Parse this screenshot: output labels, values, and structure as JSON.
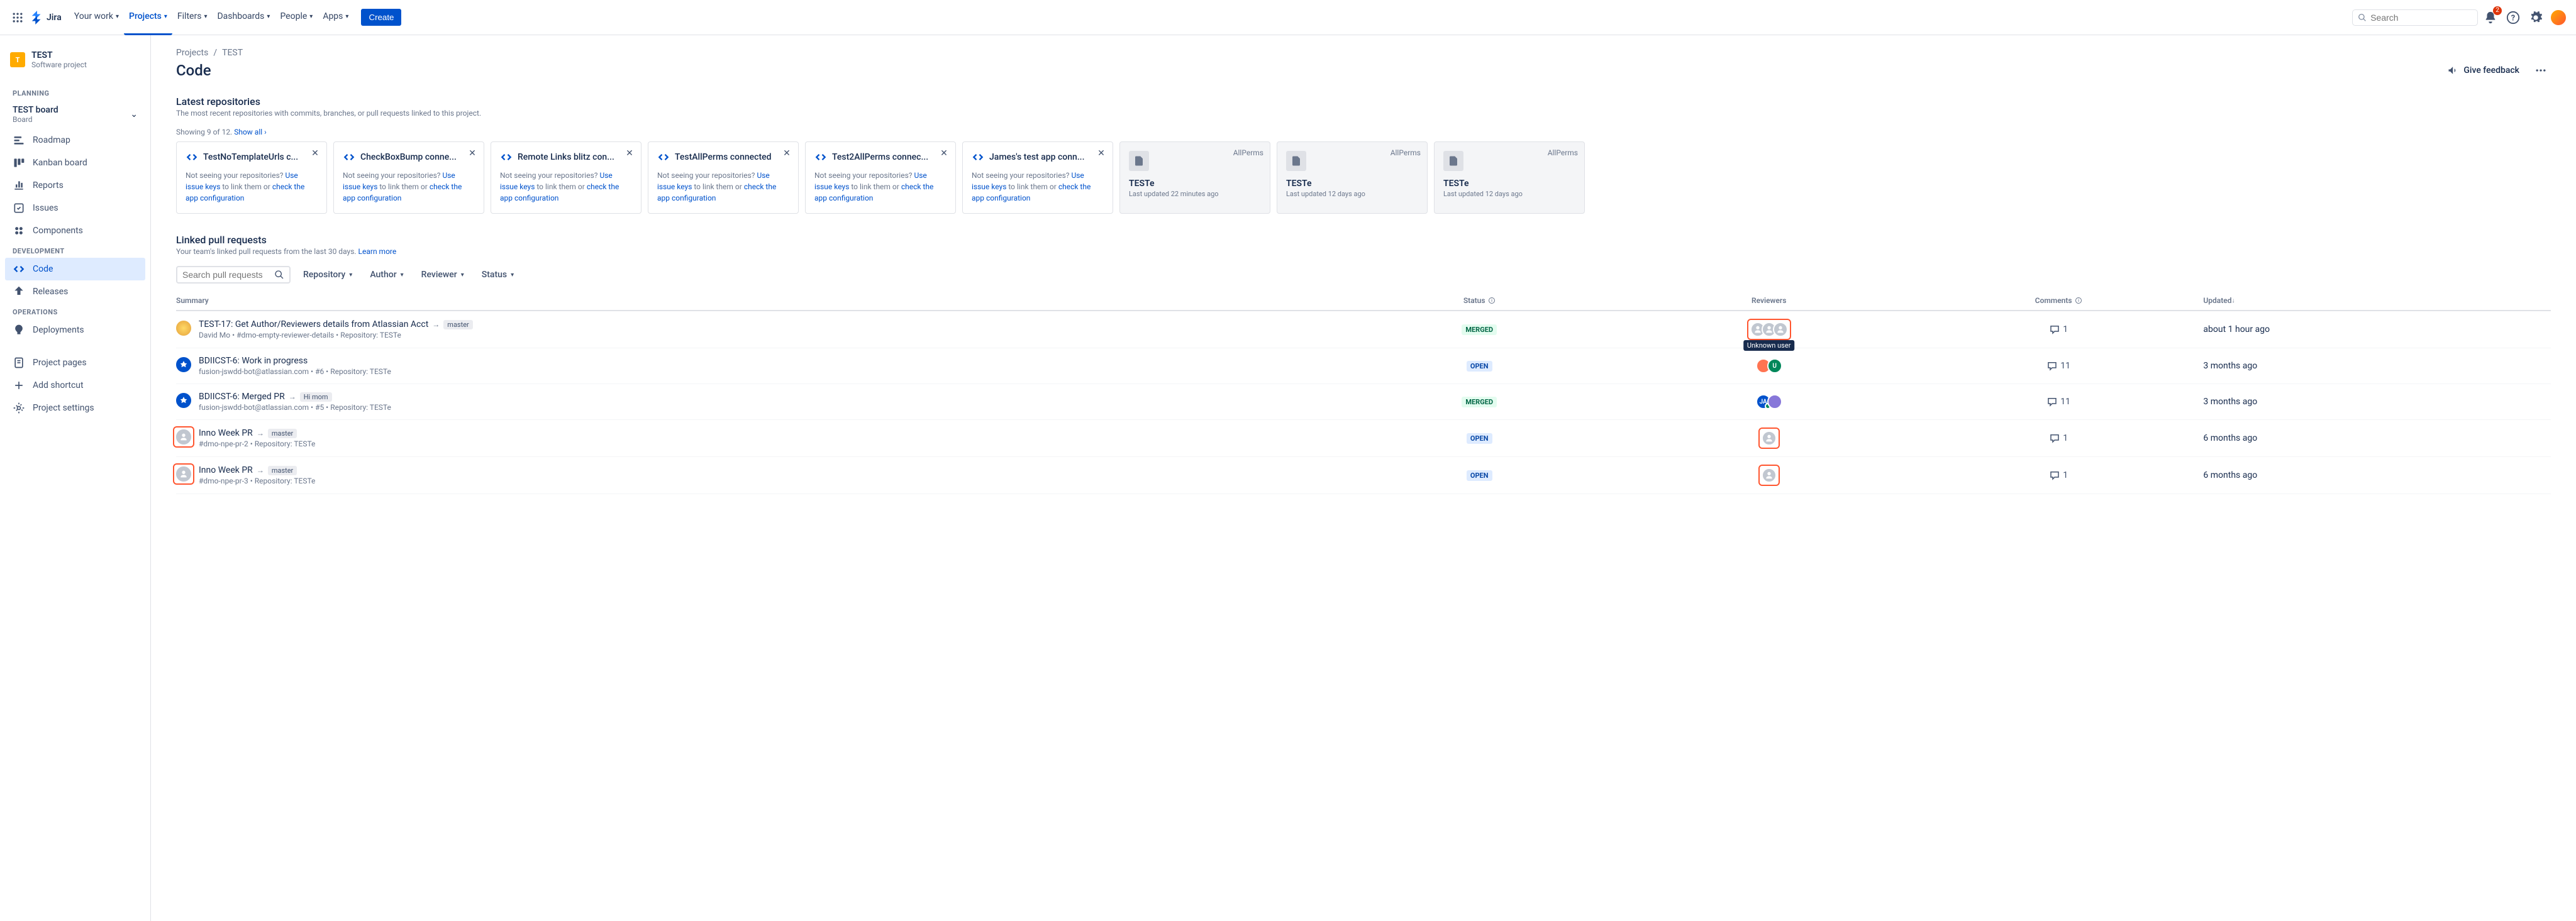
{
  "topnav": {
    "logo": "Jira",
    "items": [
      "Your work",
      "Projects",
      "Filters",
      "Dashboards",
      "People",
      "Apps"
    ],
    "active_index": 1,
    "create": "Create",
    "search_placeholder": "Search",
    "notif_count": "2"
  },
  "sidebar": {
    "project": {
      "name": "TEST",
      "type": "Software project",
      "initials": "T"
    },
    "board": {
      "name": "TEST board",
      "sub": "Board"
    },
    "sections": [
      {
        "title": "PLANNING",
        "has_board": true,
        "items": [
          {
            "label": "Roadmap",
            "icon": "roadmap"
          },
          {
            "label": "Kanban board",
            "icon": "board"
          },
          {
            "label": "Reports",
            "icon": "reports"
          },
          {
            "label": "Issues",
            "icon": "issues"
          },
          {
            "label": "Components",
            "icon": "components"
          }
        ]
      },
      {
        "title": "DEVELOPMENT",
        "items": [
          {
            "label": "Code",
            "icon": "code",
            "selected": true
          },
          {
            "label": "Releases",
            "icon": "releases"
          }
        ]
      },
      {
        "title": "OPERATIONS",
        "items": [
          {
            "label": "Deployments",
            "icon": "deployments"
          }
        ]
      }
    ],
    "footer_items": [
      {
        "label": "Project pages",
        "icon": "pages"
      },
      {
        "label": "Add shortcut",
        "icon": "add"
      },
      {
        "label": "Project settings",
        "icon": "settings"
      }
    ]
  },
  "breadcrumb": {
    "a": "Projects",
    "b": "TEST"
  },
  "page": {
    "title": "Code",
    "feedback": "Give feedback"
  },
  "latest_repos": {
    "title": "Latest repositories",
    "sub": "The most recent repositories with commits, branches, or pull requests linked to this project.",
    "showing": "Showing 9 of 12.",
    "show_all": "Show all",
    "help_prefix": "Not seeing your repositories? ",
    "help_link1": "Use issue keys",
    "help_mid": " to link them or ",
    "help_link2": "check the app configuration",
    "cards": [
      {
        "name": "TestNoTemplateUrls c...",
        "type": "link"
      },
      {
        "name": "CheckBoxBump conne...",
        "type": "link"
      },
      {
        "name": "Remote Links blitz con...",
        "type": "link"
      },
      {
        "name": "TestAllPerms connected",
        "type": "link"
      },
      {
        "name": "Test2AllPerms connec...",
        "type": "link"
      },
      {
        "name": "James's test app conn...",
        "type": "link"
      },
      {
        "name": "TESTe",
        "perm": "AllPerms",
        "updated": "Last updated 22 minutes ago",
        "type": "gray"
      },
      {
        "name": "TESTe",
        "perm": "AllPerms",
        "updated": "Last updated 12 days ago",
        "type": "gray"
      },
      {
        "name": "TESTe",
        "perm": "AllPerms",
        "updated": "Last updated 12 days ago",
        "type": "gray"
      }
    ]
  },
  "linked_prs": {
    "title": "Linked pull requests",
    "sub_pre": "Your team's linked pull requests from the last 30 days. ",
    "learn_more": "Learn more",
    "search_placeholder": "Search pull requests",
    "filters": [
      "Repository",
      "Author",
      "Reviewer",
      "Status"
    ],
    "columns": {
      "summary": "Summary",
      "status": "Status",
      "reviewers": "Reviewers",
      "comments": "Comments",
      "updated": "Updated"
    },
    "tooltip": "Unknown user",
    "rows": [
      {
        "avatar": "doge",
        "title": "TEST-17: Get Author/Reviewers details from Atlassian Acct",
        "branch": "master",
        "meta": "David Mo • #dmo-empty-reviewer-details • Repository: TESTe",
        "status": "MERGED",
        "reviewers": [
          {
            "c": "#C1C7D0",
            "t": "?"
          },
          {
            "c": "#C1C7D0",
            "t": "?"
          },
          {
            "c": "#C1C7D0",
            "t": "?"
          }
        ],
        "rev_highlight": true,
        "avatar_highlight": false,
        "tooltip": true,
        "comments": "1",
        "updated": "about 1 hour ago"
      },
      {
        "avatar": "bot",
        "title": "BDIICST-6: Work in progress",
        "branch": "",
        "meta": "fusion-jswdd-bot@atlassian.com • #6 • Repository: TESTe",
        "status": "OPEN",
        "reviewers": [
          {
            "c": "#FF7452",
            "t": ""
          },
          {
            "c": "#00875A",
            "t": "U"
          }
        ],
        "rev_highlight": false,
        "avatar_highlight": false,
        "comments": "11",
        "updated": "3 months ago"
      },
      {
        "avatar": "bot",
        "title": "BDIICST-6: Merged PR",
        "branch": "Hi mom",
        "meta": "fusion-jswdd-bot@atlassian.com • #5 • Repository: TESTe",
        "status": "MERGED",
        "reviewers": [
          {
            "c": "#0052CC",
            "t": "JA",
            "badge": true
          },
          {
            "c": "#8777D9",
            "t": ""
          }
        ],
        "rev_highlight": false,
        "avatar_highlight": false,
        "comments": "11",
        "updated": "3 months ago"
      },
      {
        "avatar": "unknown",
        "title": "Inno Week PR",
        "branch": "master",
        "meta": "#dmo-npe-pr-2 • Repository: TESTe",
        "status": "OPEN",
        "reviewers": [
          {
            "c": "#C1C7D0",
            "t": "?",
            "single": true
          }
        ],
        "rev_highlight": true,
        "avatar_highlight": true,
        "comments": "1",
        "updated": "6 months ago"
      },
      {
        "avatar": "unknown",
        "title": "Inno Week PR",
        "branch": "master",
        "meta": "#dmo-npe-pr-3 • Repository: TESTe",
        "status": "OPEN",
        "reviewers": [
          {
            "c": "#C1C7D0",
            "t": "?",
            "single": true
          }
        ],
        "rev_highlight": true,
        "avatar_highlight": true,
        "comments": "1",
        "updated": "6 months ago"
      }
    ]
  }
}
